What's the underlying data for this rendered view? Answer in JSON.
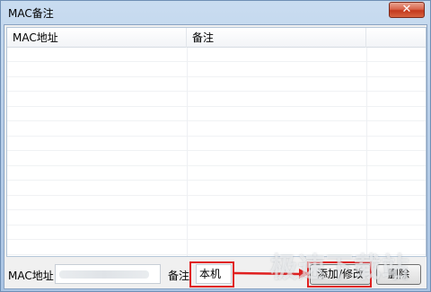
{
  "window": {
    "title": "MAC备注",
    "close_label": "✕"
  },
  "list": {
    "columns": [
      "MAC地址",
      "备注",
      ""
    ],
    "rows": []
  },
  "form": {
    "mac_label": "MAC地址",
    "note_label": "备注",
    "note_value": "本机",
    "add_button": "添加/修改",
    "delete_button": "删除"
  },
  "watermark": "极速下载站",
  "colors": {
    "highlight": "#e02020",
    "title_bar": "#b8cfe9",
    "close_button": "#c3391d"
  }
}
